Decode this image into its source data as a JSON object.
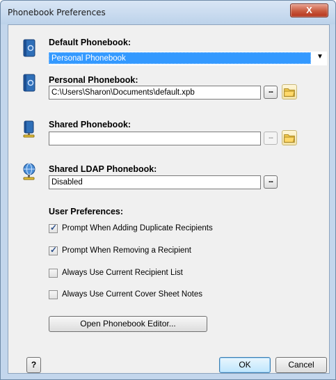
{
  "window": {
    "title": "Phonebook Preferences",
    "close_glyph": "X"
  },
  "default_phonebook": {
    "label": "Default Phonebook:",
    "selected": "Personal Phonebook",
    "icon": "blue-book-icon"
  },
  "personal_phonebook": {
    "label": "Personal Phonebook:",
    "path": "C:\\Users\\Sharon\\Documents\\default.xpb",
    "browse_label": "...",
    "icon": "blue-book-icon"
  },
  "shared_phonebook": {
    "label": "Shared Phonebook:",
    "path": "",
    "browse_label": "...",
    "icon": "network-book-icon"
  },
  "ldap_phonebook": {
    "label": "Shared LDAP Phonebook:",
    "value": "Disabled",
    "browse_label": "...",
    "icon": "globe-network-icon"
  },
  "user_preferences": {
    "label": "User Preferences:",
    "options": [
      {
        "label": "Prompt When Adding Duplicate Recipients",
        "checked": true
      },
      {
        "label": "Prompt When Removing a Recipient",
        "checked": true
      },
      {
        "label": "Always Use Current Recipient List",
        "checked": false
      },
      {
        "label": "Always Use Current Cover Sheet Notes",
        "checked": false
      }
    ],
    "check_glyph": "✓"
  },
  "buttons": {
    "open_editor": "Open Phonebook Editor...",
    "help": "?",
    "ok": "OK",
    "cancel": "Cancel"
  },
  "colors": {
    "selection": "#3399ff",
    "folder": "#f2c94c",
    "book": "#2f6fb8"
  }
}
